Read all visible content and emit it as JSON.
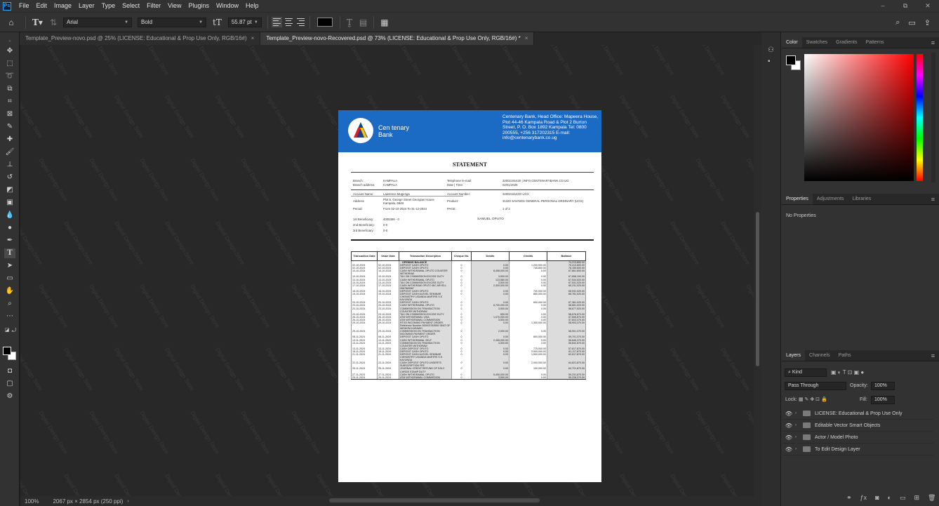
{
  "menubar": {
    "app_logo": "Ps",
    "items": [
      "File",
      "Edit",
      "Image",
      "Layer",
      "Type",
      "Select",
      "Filter",
      "View",
      "Plugins",
      "Window",
      "Help"
    ],
    "window_controls": [
      "–",
      "⧉",
      "✕"
    ]
  },
  "options_bar": {
    "font_family": "Arial",
    "font_style": "Bold",
    "font_size": "55.87 pt",
    "text_color": "#000000"
  },
  "tabs": [
    {
      "label": "Template_Preview-novo.psd @ 25% (LICENSE: Educational & Prop Use Only, RGB/16#)",
      "active": false
    },
    {
      "label": "Template_Preview-novo-Recovered.psd @ 73% (LICENSE: Educational & Prop Use Only, RGB/16#) *",
      "active": true
    }
  ],
  "status_bar": {
    "zoom": "100%",
    "doc_info": "2067 px × 2854 px (250 ppi)"
  },
  "document": {
    "bank_name_line1": "Cen tenary",
    "bank_name_line2": "Bank",
    "bank_address": "Centenary Bank, Head Office: Mapeera House, Plot 44-46 Kampala Road & Plot 2 Burton Street, P. O. Box 1892 Kampala Tel: 0800 200555, +256 317202315 E-mail: info@centenarybank.co.ug",
    "title": "STATEMENT",
    "branch_label": "Branch:",
    "branch_value": "KAMPALA",
    "branch_address_label": "Branch address:",
    "branch_address_value": "KAMPALA",
    "tel_label": "Telephone /e-mail:",
    "tel_value": "32002191420 | INFO.CENTENARYBANK.CO.UG",
    "date_label": "Date | Time:",
    "date_value": "02/01/2025",
    "account_name_label": "Account Name:",
    "account_name_value": "Lawrence Mugenga",
    "account_number_label": "Account Number:",
    "account_number_value": "3200219142O UGX",
    "address_label": "Address",
    "address_value": "Plot 5, George Street Georgian House Kampala, 6848",
    "product_label": "Product:",
    "product_value": "31320 SAVINGS GENERAL PERSONAL ORDINARY (UGX)",
    "period_label": "Period:",
    "period_value": "From 02-10-2024    To 31-12-2024",
    "page_label": "PAGE:",
    "page_value": "1 of 2",
    "ben1_label": "1st Beneficiary:",
    "ben1_value": "4005386 - 0",
    "ben1_name": "SAMUEL OPUTO",
    "ben2_label": "2nd Beneficiary:",
    "ben2_value": "0-0",
    "ben3_label": "3rd Beneficiary:",
    "ben3_value": "0-0",
    "table": {
      "headers": [
        "Transaction Date",
        "Value Date",
        "Transaction Description",
        "Cheque No.",
        "Debits",
        "Credits",
        "Balance"
      ],
      "rows": [
        [
          "",
          "",
          "OPENING BALANCE",
          "",
          "",
          "",
          "74,213,800.00"
        ],
        [
          "02-10-2024",
          "02-10-2024",
          "DEPOSIT CASH OPUTO",
          "0",
          "0.00",
          "1,200,000.00",
          "75,413,800.00"
        ],
        [
          "02-10-2024",
          "02-10-2024",
          "DEPOSIT CASH OPUTO",
          "0",
          "0.00",
          "745,800.00",
          "76,159,600.00"
        ],
        [
          "10-10-2024",
          "10-10-2024",
          "CASH WITHDRAWAL OPUTO COUNTER WITHDRAW",
          "0",
          "8,498,000.00",
          "0.00",
          "67,661,600.00"
        ],
        [
          "10-10-2024",
          "10-10-2024",
          "TAX ON COMMISSION EXCISE DUTY",
          "0",
          "3,500.00",
          "0.00",
          "67,658,100.00"
        ],
        [
          "13-10-2024",
          "13-10-2024",
          "CASH WITHDRAWAL OPUTO",
          "0",
          "123,580.00",
          "0.00",
          "67,534,520.00"
        ],
        [
          "13-10-2024",
          "13-10-2024",
          "TAX ON COMMISSION EXCISE DUTY",
          "0",
          "3,500.00",
          "0.00",
          "67,531,020.00"
        ],
        [
          "17-10-2024",
          "17-10-2024",
          "CASH WITHDRAW OPUTO B/C ARYELL 0567869987",
          "0",
          "2,300,000.00",
          "0.00",
          "65,231,020.00"
        ],
        [
          "18-10-2024",
          "18-10-2024",
          "DEPOSIT CASH OPUTO",
          "0",
          "0.00",
          "700,000.00",
          "65,931,020.00"
        ],
        [
          "19-10-2024",
          "19-10-2024",
          "DEPOSIT CASH ALEVEL SEMINAR CHEMISTRY UGANDA MARTRS S.S KAYUNGA",
          "0",
          "0.00",
          "850,000.00",
          "66,781,020.00"
        ],
        [
          "20-10-2024",
          "20-10-2024",
          "DEPOSIT CASH OPUTO",
          "0",
          "0.00",
          "600,000.00",
          "67,381,020.00"
        ],
        [
          "23-10-2024",
          "23-10-2024",
          "CASH WITHDRAWAL OPUTO",
          "0",
          "8,700,000.00",
          "0.00",
          "58,681,020.00"
        ],
        [
          "23-10-2024",
          "23-10-2024",
          "COMMISSION ON TRANSACTION COUNTER WITHDRAW",
          "0",
          "3,500.00",
          "0.00",
          "58,677,520.00"
        ],
        [
          "23-10-2024",
          "23-10-2024",
          "TAX ON COMMISSION EXCISE DUTY",
          "0",
          "650.00",
          "0.00",
          "58,676,870.00"
        ],
        [
          "26-10-2024",
          "26-10-2024",
          "ATM WITHDRAWAL VISA",
          "0",
          "1,070,000.00",
          "0.00",
          "57,606,870.00"
        ],
        [
          "26-10-2024",
          "26-10-2024",
          "ATM WITHDRAWAL COMMISSION",
          "0",
          "3,500.00",
          "0.00",
          "57,603,370.00"
        ],
        [
          "29-10-2024",
          "29-10-2024",
          "RTGS INCOMING PAYMENT ORDER. Reference Number 000003783555 SEAT OF WISDOM KASAWO",
          "0",
          "0.00",
          "1,300,000.00",
          "58,903,370.00"
        ],
        [
          "29-10-2024",
          "29-10-2024",
          "COMMISSION ON TRANSACTION INCOMING PAYMENT ORDER.",
          "0",
          "2,000.00",
          "0.00",
          "58,901,370.00"
        ],
        [
          "08-11-2024",
          "08-11-2024",
          "DEPOSIT CASH OPUTO",
          "0",
          "0.00",
          "800,000.00",
          "59,701,370.00"
        ],
        [
          "13-11-2024",
          "13-11-2024",
          "CASH WITHDRAWAL SELF",
          "0",
          "2,455,000.00",
          "0.00",
          "56,846,370.00"
        ],
        [
          "13-11-2024",
          "13-11-2024",
          "COMMISSION ON TRANSACTION COUNTER WITHDRAW",
          "0",
          "3,500.00",
          "0.00",
          "56,842,870.00"
        ],
        [
          "13-11-2024",
          "13-11-2024",
          "CASH DEPOSIT OPUTO",
          "0",
          "0.00",
          "775,000.00",
          "57,617,870.00"
        ],
        [
          "18-11-2024",
          "18-11-2024",
          "DEPOSIT CASH OPUTO",
          "0",
          "0.00",
          "3,500,000.00",
          "61,117,870.00"
        ],
        [
          "21-11-2024",
          "21-11-2024",
          "DEPOSIT CASH ALEVEL SEMINAR CHEMISTRY UGANDA MARTRS S.S KAYUNGA",
          "0",
          "0.00",
          "1,500,000.00",
          "62,617,870.00"
        ],
        [
          "22-11-2024",
          "22-11-2024",
          "CASH DEPOSIT OPUTO LINSERTS SUBSCRIPTION FEE",
          "0",
          "0.00",
          "2,000,000.00",
          "64,621,870.00"
        ],
        [
          "25-11-2024",
          "25-11-2024",
          "JOURNAL CREDIT REFUND OF DSLC CHRGE STAMP DUTY",
          "0",
          "0.00",
          "100,000.00",
          "64,721,870.00"
        ],
        [
          "27-11-2024",
          "27-11-2024",
          "CASH WITHDRAWAL OPUTO",
          "0",
          "5,490,000.00",
          "0.00",
          "59,231,870.00"
        ],
        [
          "29-11-2024",
          "29-11-2024",
          "ATM WITHDRAWAL COMMISSION",
          "0",
          "3,500.00",
          "0.00",
          "59,228,370.00"
        ]
      ]
    }
  },
  "panels": {
    "color_tabs": [
      "Color",
      "Swatches",
      "Gradients",
      "Patterns"
    ],
    "properties_tabs": [
      "Properties",
      "Adjustments",
      "Libraries"
    ],
    "properties_text": "No Properties",
    "layers_tabs": [
      "Layers",
      "Channels",
      "Paths"
    ],
    "kind_filter": "Kind",
    "blend_mode": "Pass Through",
    "opacity_label": "Opacity:",
    "opacity_value": "100%",
    "lock_label": "Lock:",
    "fill_label": "Fill:",
    "fill_value": "100%",
    "layers": [
      "LICENSE: Educational & Prop Use Only",
      "Editable Vector Smart Objects",
      "Actor / Model Photo",
      "To Edit Design Layer"
    ]
  },
  "watermark": "Digital Design Store"
}
